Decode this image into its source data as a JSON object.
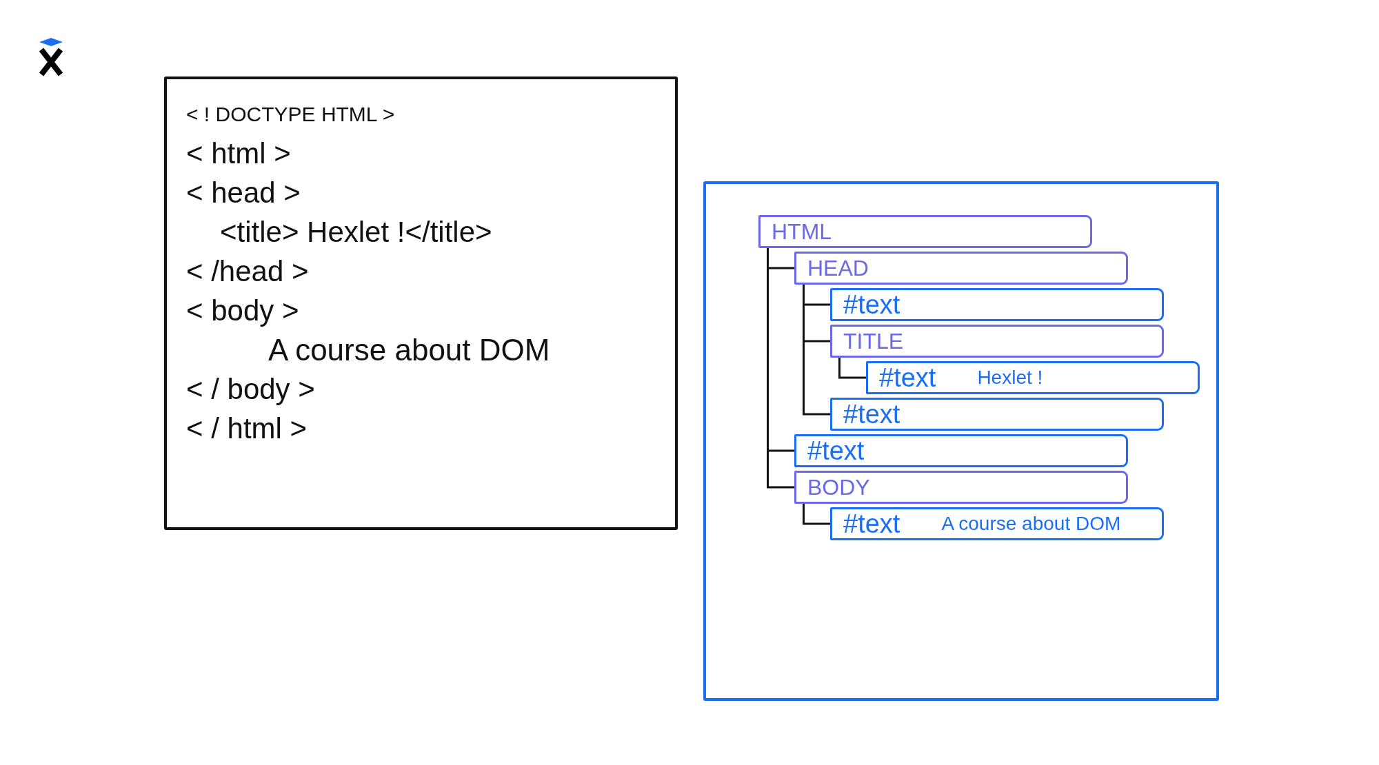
{
  "code_panel": {
    "lines": [
      {
        "kind": "doctype",
        "text": "< ! DOCTYPE HTML >"
      },
      {
        "kind": "tag",
        "text": "< html >"
      },
      {
        "kind": "tag",
        "text": "< head >",
        "children": [
          {
            "kind": "tag",
            "text": "<title> Hexlet !</title>"
          }
        ]
      },
      {
        "kind": "tag",
        "text": "< /head >"
      },
      {
        "kind": "tag",
        "text": "< body >",
        "children": [
          {
            "kind": "text",
            "text": "A course about DOM"
          }
        ]
      },
      {
        "kind": "tag",
        "text": "< / body >"
      },
      {
        "kind": "tag",
        "text": "< / html >"
      }
    ]
  },
  "dom_tree": {
    "root": {
      "kind": "element",
      "name": "HTML",
      "children": [
        {
          "kind": "element",
          "name": "HEAD",
          "children": [
            {
              "kind": "text",
              "name": "#text"
            },
            {
              "kind": "element",
              "name": "TITLE",
              "children": [
                {
                  "kind": "text",
                  "name": "#text",
                  "value": "Hexlet !"
                }
              ]
            },
            {
              "kind": "text",
              "name": "#text"
            }
          ]
        },
        {
          "kind": "text",
          "name": "#text"
        },
        {
          "kind": "element",
          "name": "BODY",
          "children": [
            {
              "kind": "text",
              "name": "#text",
              "value": "A course about DOM"
            }
          ]
        }
      ]
    }
  }
}
